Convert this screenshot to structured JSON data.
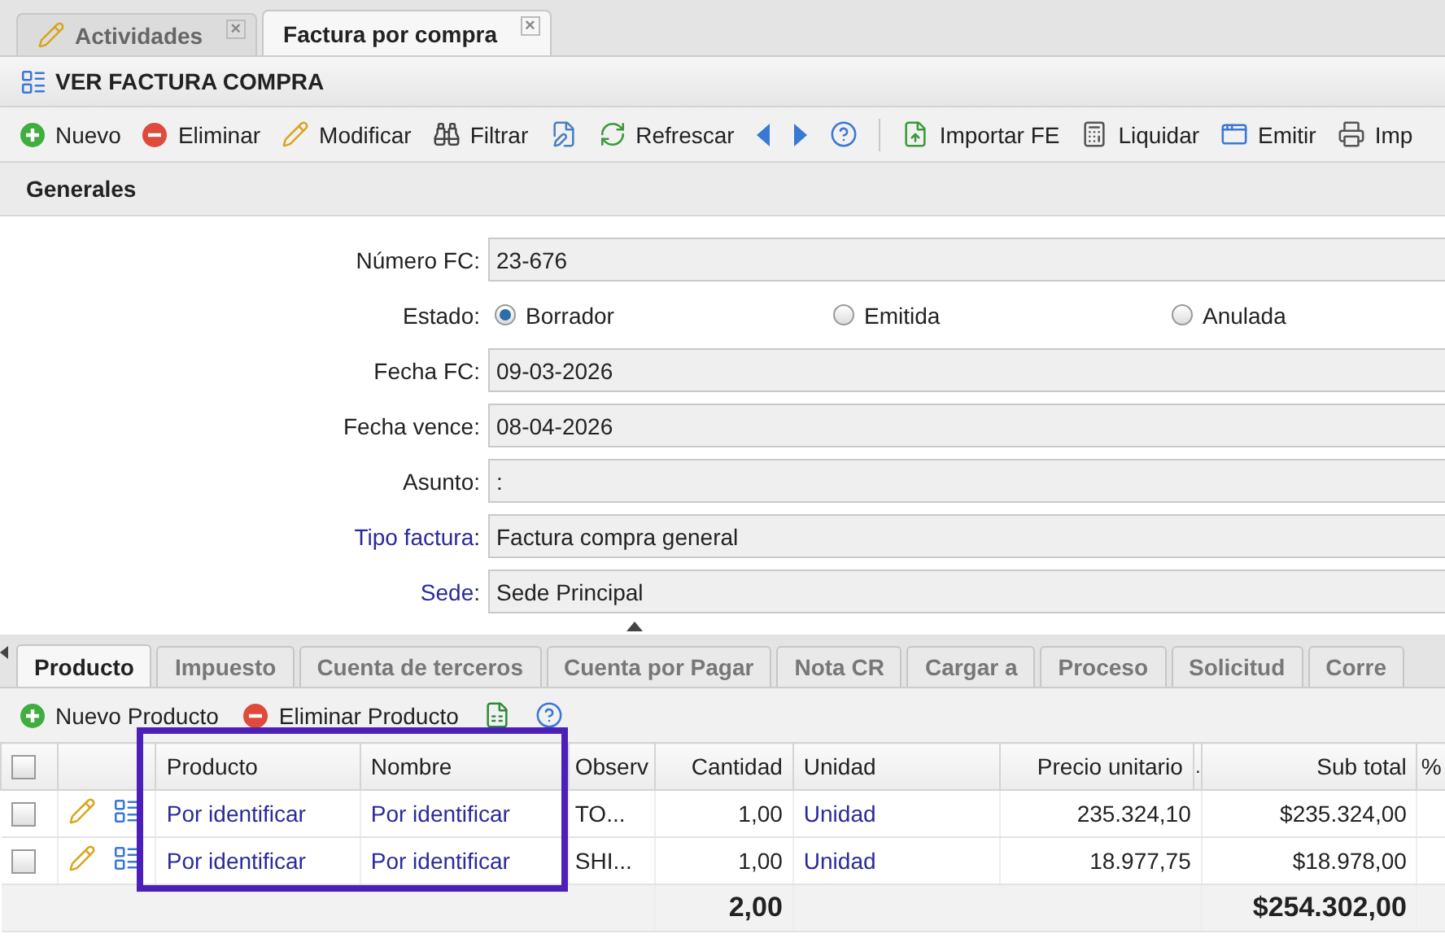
{
  "window_tabs": [
    {
      "label": "Actividades",
      "selected": false,
      "close": "×"
    },
    {
      "label": "Factura por compra",
      "selected": true,
      "close": "×"
    }
  ],
  "view_title": "VER FACTURA COMPRA",
  "toolbar": [
    {
      "kind": "button",
      "label": "Nuevo"
    },
    {
      "kind": "button",
      "label": "Eliminar"
    },
    {
      "kind": "button",
      "label": "Modificar"
    },
    {
      "kind": "button",
      "label": "Filtrar"
    },
    {
      "kind": "icon"
    },
    {
      "kind": "button",
      "label": "Refrescar"
    },
    {
      "kind": "icon"
    },
    {
      "kind": "icon"
    },
    {
      "kind": "icon"
    },
    {
      "kind": "separator"
    },
    {
      "kind": "button",
      "label": "Importar FE"
    },
    {
      "kind": "button",
      "label": "Liquidar"
    },
    {
      "kind": "button",
      "label": "Emitir"
    },
    {
      "kind": "button",
      "label": "Imp"
    }
  ],
  "section_title": "Generales",
  "form": [
    {
      "kind": "text",
      "label": "Número FC",
      "linked": false,
      "value": "23-676"
    },
    {
      "kind": "radio",
      "label": "Estado",
      "linked": false,
      "options": [
        {
          "label": "Borrador",
          "selected": true
        },
        {
          "label": "Emitida",
          "selected": false
        },
        {
          "label": "Anulada",
          "selected": false
        }
      ]
    },
    {
      "kind": "text",
      "label": "Fecha FC",
      "linked": false,
      "value": "09-03-2026"
    },
    {
      "kind": "text",
      "label": "Fecha vence",
      "linked": false,
      "value": "08-04-2026"
    },
    {
      "kind": "text",
      "label": "Asunto",
      "linked": false,
      "value": ":"
    },
    {
      "kind": "text",
      "label": "Tipo factura",
      "linked": true,
      "value": "Factura compra general"
    },
    {
      "kind": "text",
      "label": "Sede",
      "linked": true,
      "value": "Sede Principal"
    }
  ],
  "detail_tabs": [
    {
      "label": "Producto",
      "selected": true
    },
    {
      "label": "Impuesto",
      "selected": false
    },
    {
      "label": "Cuenta de terceros",
      "selected": false
    },
    {
      "label": "Cuenta por Pagar",
      "selected": false
    },
    {
      "label": "Nota CR",
      "selected": false
    },
    {
      "label": "Cargar a",
      "selected": false
    },
    {
      "label": "Proceso",
      "selected": false
    },
    {
      "label": "Solicitud",
      "selected": false
    },
    {
      "label": "Corre",
      "selected": false
    }
  ],
  "detail_toolbar": [
    {
      "kind": "button",
      "label": "Nuevo Producto"
    },
    {
      "kind": "button",
      "label": "Eliminar Producto"
    },
    {
      "kind": "icon"
    },
    {
      "kind": "icon"
    }
  ],
  "table": {
    "select_all_checked": false,
    "columns": [
      "Producto",
      "Nombre",
      "Observ",
      "Cantidad",
      "Unidad",
      "Precio unitario",
      ".",
      "Sub total",
      "%"
    ],
    "rows": [
      {
        "checked": false,
        "producto": "Por identificar",
        "nombre": "Por identificar",
        "observ": "TO...",
        "cantidad": "1,00",
        "unidad": "Unidad",
        "precio": "235.324,10",
        "subtotal": "$235.324,00"
      },
      {
        "checked": false,
        "producto": "Por identificar",
        "nombre": "Por identificar",
        "observ": "SHI...",
        "cantidad": "1,00",
        "unidad": "Unidad",
        "precio": "18.977,75",
        "subtotal": "$18.978,00"
      }
    ],
    "totals": {
      "cantidad": "2,00",
      "subtotal": "$254.302,00"
    }
  },
  "highlight": {
    "color": "#4b1fb8"
  },
  "label_separator": ":"
}
